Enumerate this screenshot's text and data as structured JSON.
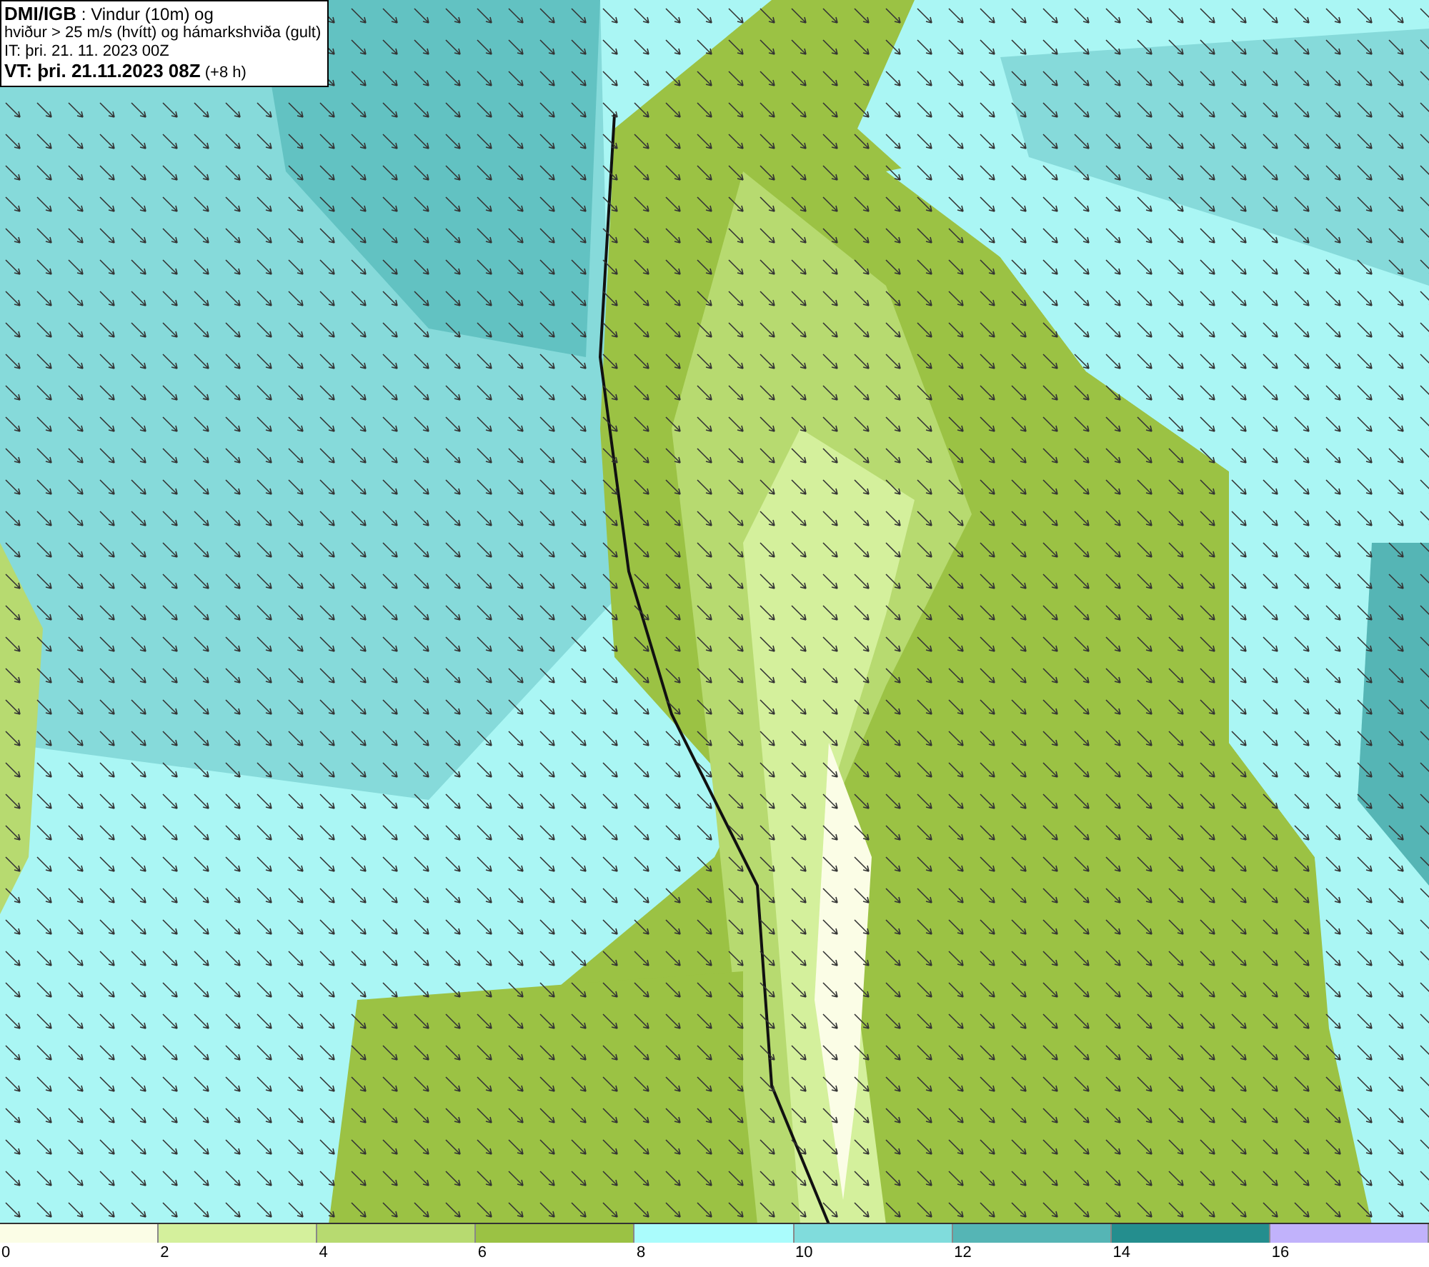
{
  "title_box": {
    "lines": [
      "**DMI/IGB** : Vindur (10m) og",
      "hviður > 25 m/s (hvítt) og hámarkshviða (gult)",
      "IT: þri. 21. 11. 2023 00Z",
      "**VT: þri. 21.11.2023 08Z** (+8 h)"
    ]
  },
  "legend": {
    "segments": [
      {
        "color": "#fbfde6",
        "label": "0"
      },
      {
        "color": "#d4f09c",
        "label": "2"
      },
      {
        "color": "#b7da70",
        "label": "4"
      },
      {
        "color": "#9bc244",
        "label": "6"
      },
      {
        "color": "#aafcfc",
        "label": "8"
      },
      {
        "color": "#80dcdc",
        "label": "10"
      },
      {
        "color": "#55b5b5",
        "label": "12"
      },
      {
        "color": "#248e8e",
        "label": "14"
      },
      {
        "color": "#c1b2fb",
        "label": "16"
      }
    ]
  }
}
